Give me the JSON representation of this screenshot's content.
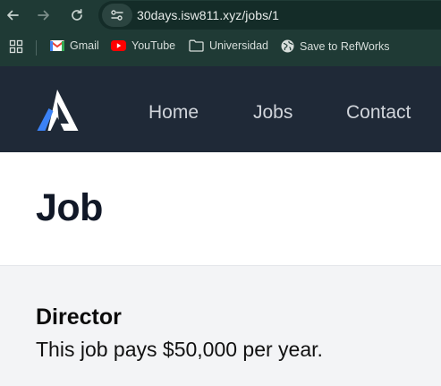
{
  "browser": {
    "url": "30days.isw811.xyz/jobs/1",
    "bookmarks": [
      {
        "label": "Gmail",
        "icon": "gmail-icon"
      },
      {
        "label": "YouTube",
        "icon": "youtube-icon"
      },
      {
        "label": "Universidad",
        "icon": "folder-icon"
      },
      {
        "label": "Save to RefWorks",
        "icon": "globe-icon"
      }
    ]
  },
  "site": {
    "nav": [
      {
        "label": "Home"
      },
      {
        "label": "Jobs"
      },
      {
        "label": "Contact"
      }
    ],
    "colors": {
      "header_bg": "#1f2937",
      "nav_text": "#d1d5db",
      "content_bg": "#f3f4f6",
      "logo_blue": "#3b82f6"
    }
  },
  "page": {
    "title": "Job",
    "job": {
      "title": "Director",
      "description": "This job pays $50,000 per year."
    }
  }
}
